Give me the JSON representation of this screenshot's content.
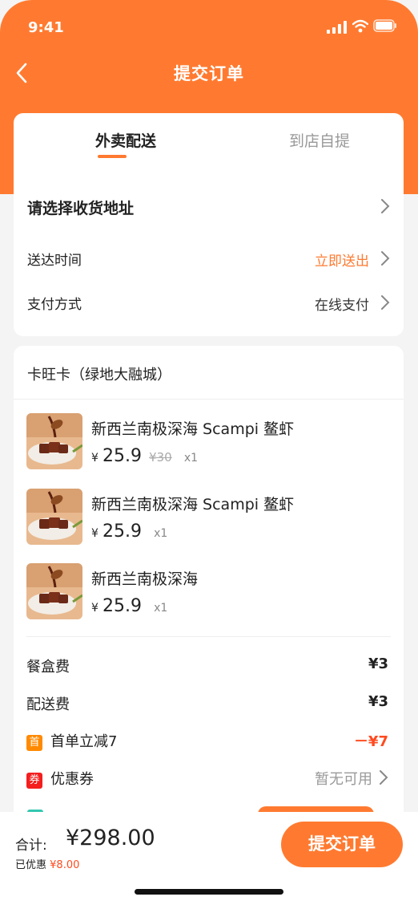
{
  "status": {
    "time": "9:41"
  },
  "nav": {
    "title": "提交订单"
  },
  "tabs": [
    {
      "label": "外卖配送",
      "active": true
    },
    {
      "label": "到店自提",
      "active": false
    }
  ],
  "address": {
    "label": "请选择收货地址"
  },
  "delivery_time": {
    "label": "送达时间",
    "value": "立即送出"
  },
  "payment": {
    "label": "支付方式",
    "value": "在线支付"
  },
  "store": {
    "name": "卡旺卡（绿地大融城）"
  },
  "items": [
    {
      "name": "新西兰南极深海 Scampi 鳌虾",
      "currency": "¥",
      "price": "25.9",
      "original": "¥30",
      "qty": "x1"
    },
    {
      "name": "新西兰南极深海 Scampi 鳌虾",
      "currency": "¥",
      "price": "25.9",
      "original": "",
      "qty": "x1"
    },
    {
      "name": "新西兰南极深海",
      "currency": "¥",
      "price": "25.9",
      "original": "",
      "qty": "x1"
    }
  ],
  "fees": {
    "box": {
      "label": "餐盒费",
      "value": "¥3"
    },
    "delivery": {
      "label": "配送费",
      "value": "¥3"
    },
    "first_order": {
      "badge": "首",
      "label": "首单立减7",
      "value": "－¥7"
    },
    "coupon": {
      "badge": "券",
      "label": "优惠券",
      "value": "暂无可用"
    }
  },
  "bottom": {
    "total_label": "合计:",
    "total_value": "¥298.00",
    "discount_label": "已优惠",
    "discount_value": "¥8.00",
    "submit_label": "提交订单"
  },
  "colors": {
    "accent": "#ff7a30",
    "red": "#ff4b1f"
  }
}
